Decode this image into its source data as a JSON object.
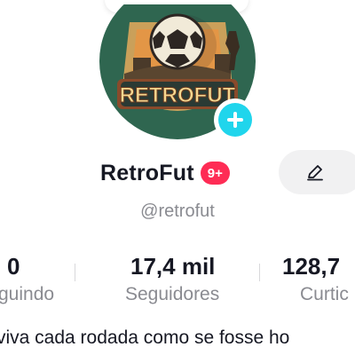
{
  "profile": {
    "logo_text": "RETROFUT",
    "display_name": "RetroFut",
    "badge": "9+",
    "handle": "@retrofut",
    "bio": "viva cada rodada como se fosse ho"
  },
  "stats": [
    {
      "value": "0",
      "label": "guindo"
    },
    {
      "value": "17,4 mil",
      "label": "Seguidores"
    },
    {
      "value": "128,7",
      "label": "Curtic"
    }
  ],
  "colors": {
    "accent": "#fe2c55",
    "add": "#20d5ec",
    "muted": "#8a8b91",
    "button_bg": "#f1f1f2"
  },
  "icons": {
    "add": "plus-icon",
    "edit": "pencil-icon"
  }
}
